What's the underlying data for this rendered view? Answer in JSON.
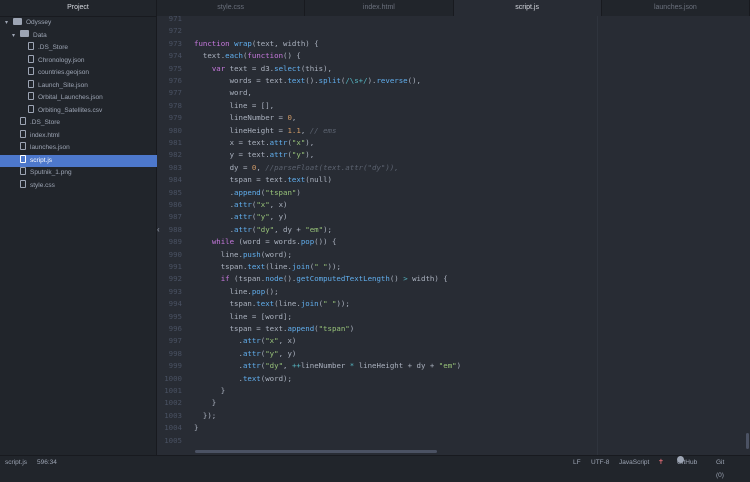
{
  "tree": {
    "header": "Project",
    "items": [
      {
        "label": "Odyssey",
        "chev": "▾",
        "type": "folder"
      },
      {
        "label": "Data",
        "chev": "▾",
        "type": "folder"
      },
      {
        "label": ".DS_Store",
        "chev": "",
        "type": "file"
      },
      {
        "label": "Chronology.json",
        "chev": "",
        "type": "file"
      },
      {
        "label": "countries.geojson",
        "chev": "",
        "type": "file"
      },
      {
        "label": "Launch_Site.json",
        "chev": "",
        "type": "file"
      },
      {
        "label": "Orbital_Launches.json",
        "chev": "",
        "type": "file"
      },
      {
        "label": "Orbiting_Satellites.csv",
        "chev": "",
        "type": "file"
      },
      {
        "label": ".DS_Store",
        "chev": "",
        "type": "file"
      },
      {
        "label": "index.html",
        "chev": "",
        "type": "file"
      },
      {
        "label": "launches.json",
        "chev": "",
        "type": "file"
      },
      {
        "label": "script.js",
        "chev": "",
        "type": "file"
      },
      {
        "label": "Sputnik_1.png",
        "chev": "",
        "type": "file"
      },
      {
        "label": "style.css",
        "chev": "",
        "type": "file"
      }
    ]
  },
  "tabs": [
    "style.css",
    "index.html",
    "script.js",
    "launches.json"
  ],
  "active_tab": "script.js",
  "selected_file": "script.js",
  "line_numbers": [
    "971",
    "972",
    "973",
    "974",
    "975",
    "976",
    "977",
    "978",
    "979",
    "980",
    "981",
    "982",
    "983",
    "984",
    "985",
    "986",
    "987",
    "988",
    "989",
    "990",
    "991",
    "992",
    "993",
    "994",
    "995",
    "996",
    "997",
    "998",
    "999",
    "1000",
    "1001",
    "1002",
    "1003",
    "1004",
    "1005"
  ],
  "code_lines": [
    "",
    "",
    "function wrap(text, width) {",
    "  text.each(function() {",
    "    var text = d3.select(this),",
    "        words = text.text().split(/\\s+/).reverse(),",
    "        word,",
    "        line = [],",
    "        lineNumber = 0,",
    "        lineHeight = 1.1, // ems",
    "        x = text.attr(\"x\"),",
    "        y = text.attr(\"y\"),",
    "        dy = 0, //parseFloat(text.attr(\"dy\")),",
    "        tspan = text.text(null)",
    "        .append(\"tspan\")",
    "        .attr(\"x\", x)",
    "        .attr(\"y\", y)",
    "        .attr(\"dy\", dy + \"em\");",
    "    while (word = words.pop()) {",
    "      line.push(word);",
    "      tspan.text(line.join(\" \"));",
    "      if (tspan.node().getComputedTextLength() > width) {",
    "        line.pop();",
    "        tspan.text(line.join(\" \"));",
    "        line = [word];",
    "        tspan = text.append(\"tspan\")",
    "          .attr(\"x\", x)",
    "          .attr(\"y\", y)",
    "          .attr(\"dy\", ++lineNumber * lineHeight + dy + \"em\")",
    "          .text(word);",
    "      }",
    "    }",
    "  });",
    "}",
    ""
  ],
  "status": {
    "file": "script.js",
    "cursor": "596:34",
    "line_ending": "LF",
    "encoding": "UTF-8",
    "grammar": "JavaScript",
    "github": "GitHub",
    "git": "Git (0)"
  },
  "colors": {
    "accent": "#4d78cc",
    "keyword": "#c678dd",
    "function": "#61afef",
    "string": "#98c379",
    "number": "#d19a66",
    "comment": "#5c6370"
  }
}
